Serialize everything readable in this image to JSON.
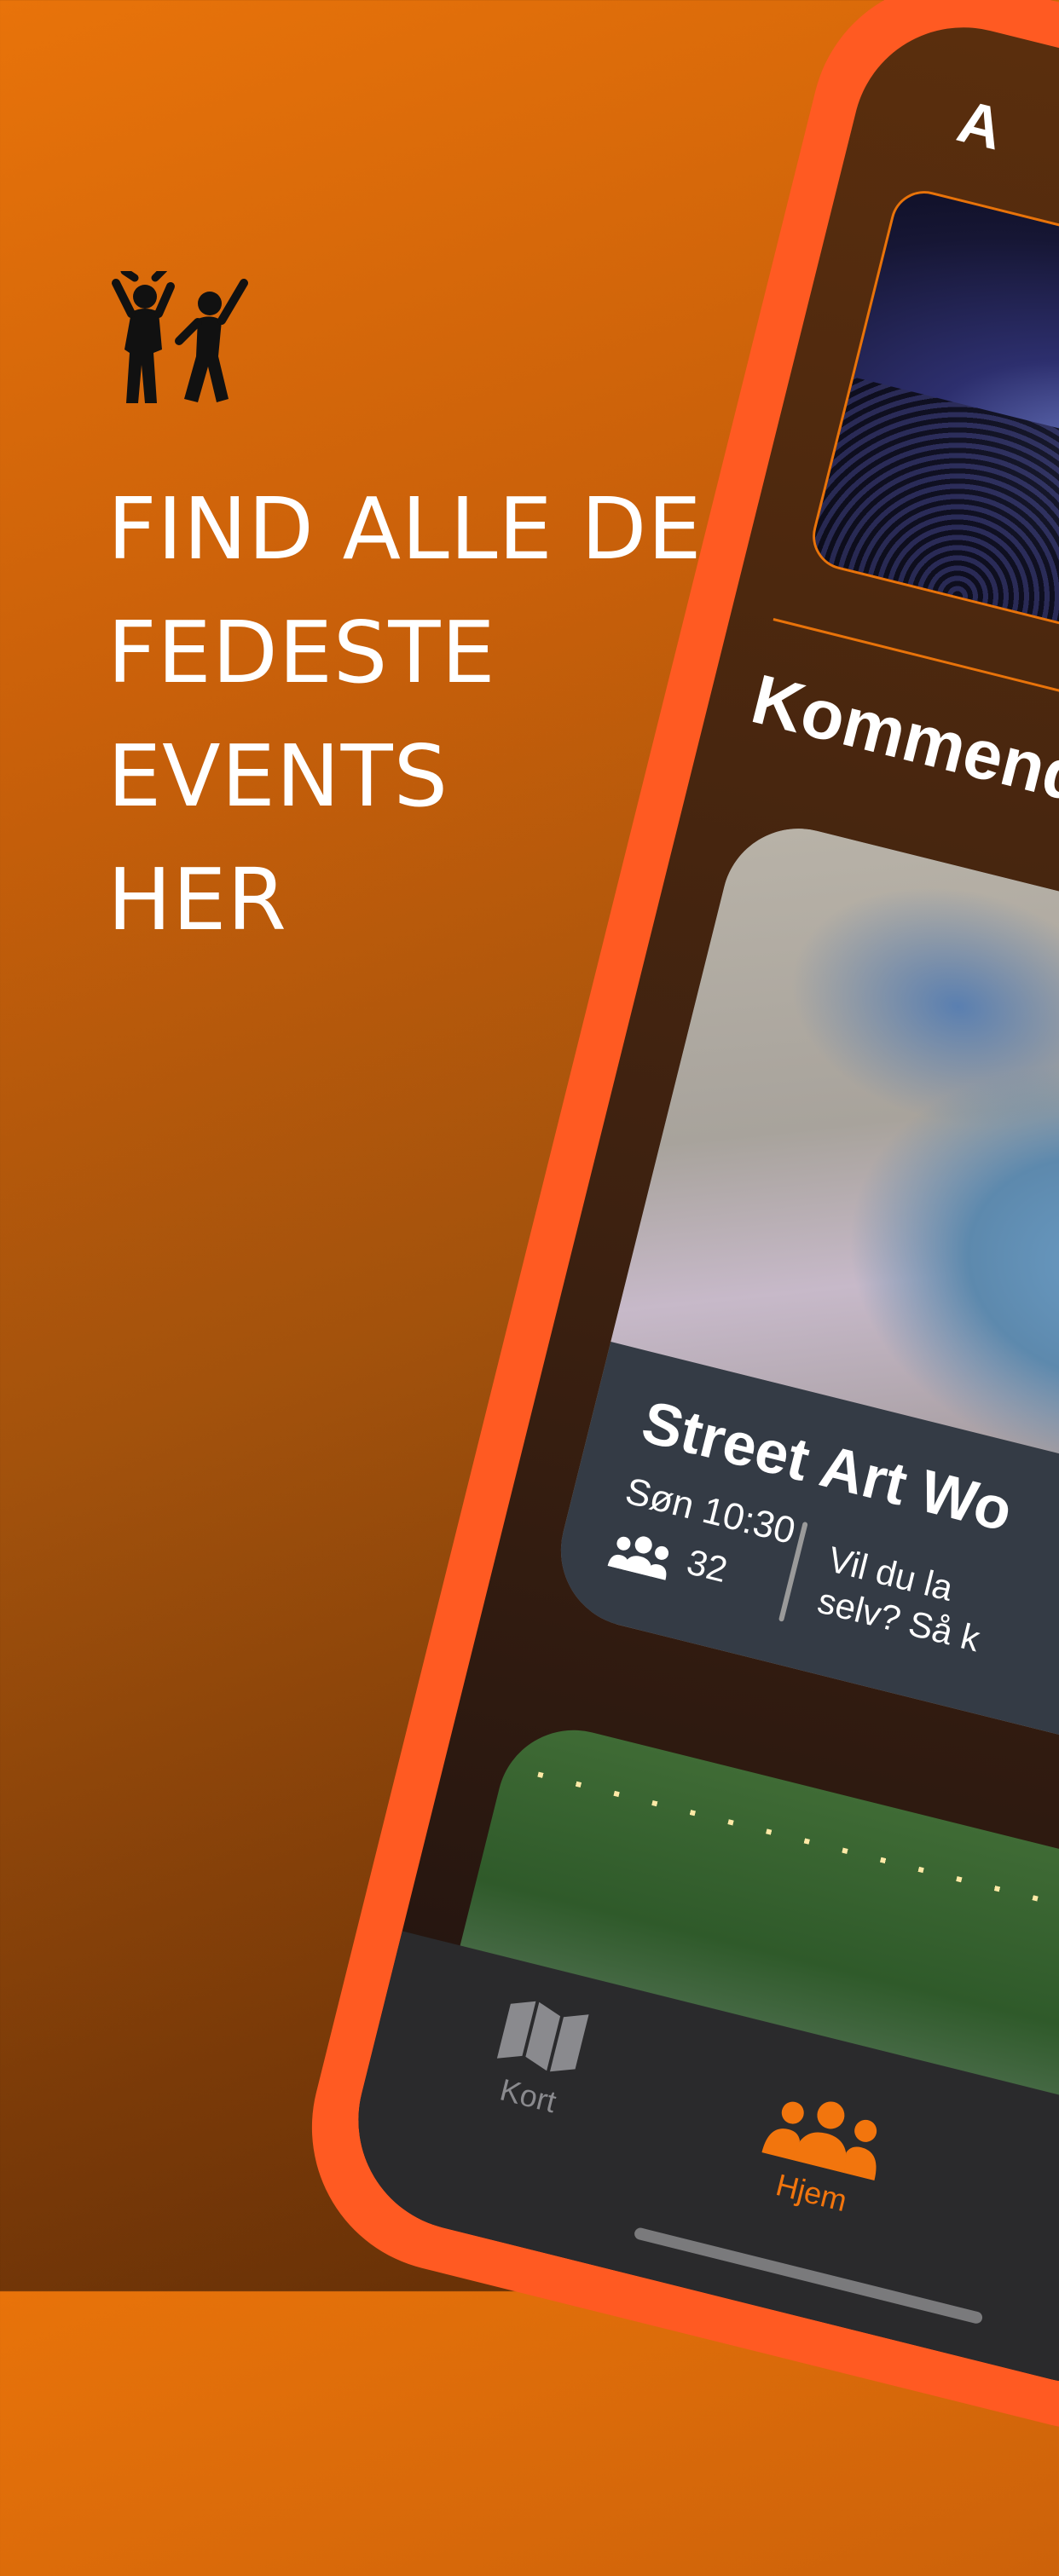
{
  "promo": {
    "headline_lines": [
      "FIND ALLE DE",
      "FEDESTE",
      "EVENTS",
      "HER"
    ]
  },
  "app": {
    "top_partial_text": "A",
    "section_title": "Kommende",
    "event": {
      "title": "Street Art Wo",
      "time": "Søn 10:30",
      "attendees": "32",
      "description_line1": "Vil du la",
      "description_line2": "selv? Så k"
    },
    "tabbar": {
      "items": [
        {
          "label": "Kort",
          "icon": "map-icon",
          "active": false
        },
        {
          "label": "Hjem",
          "icon": "people-icon",
          "active": true
        }
      ]
    }
  },
  "colors": {
    "background_top": "#e8730a",
    "background_bottom": "#5e2c06",
    "phone_frame": "#ff5a22",
    "accent": "#f2750d",
    "tab_inactive": "#8a8a8e"
  }
}
